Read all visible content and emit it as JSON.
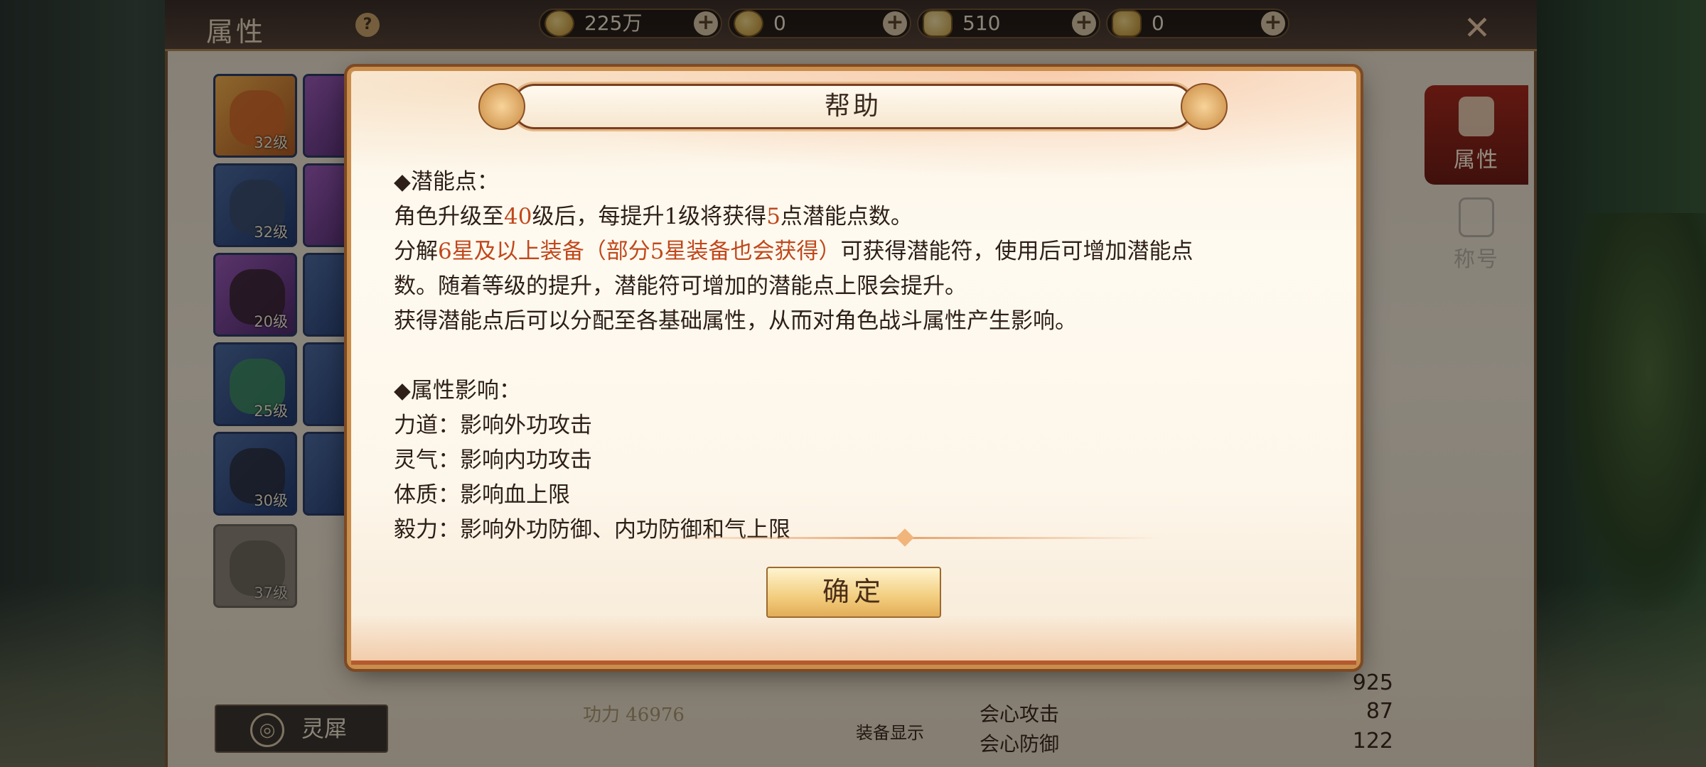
{
  "topbar": {
    "title": "属性",
    "help_symbol": "?",
    "currencies": [
      {
        "icon": "copper-coin-icon",
        "value": "225万"
      },
      {
        "icon": "gold-coin-icon",
        "value": "0"
      },
      {
        "icon": "silver-ingot-icon",
        "value": "510"
      },
      {
        "icon": "gold-ingot-icon",
        "value": "0"
      }
    ],
    "plus": "+",
    "close": "✕"
  },
  "equipment": [
    {
      "level": "32级",
      "rarity": "orange"
    },
    {
      "level": "32级",
      "rarity": "blue"
    },
    {
      "level": "20级",
      "rarity": "purple"
    },
    {
      "level": "25级",
      "rarity": "blue"
    },
    {
      "level": "30级",
      "rarity": "blue"
    },
    {
      "level": "37级",
      "rarity": "grey"
    }
  ],
  "bottom_left": {
    "label": "灵犀"
  },
  "side_tabs": [
    {
      "label": "属性",
      "active": true
    },
    {
      "label": "称号",
      "active": false
    }
  ],
  "background_stats": {
    "power": "功力 46976",
    "equip_display": "装备显示",
    "rows": [
      {
        "label": "会心攻击",
        "value": "87"
      },
      {
        "label": "会心防御",
        "value": "122"
      }
    ],
    "extra_value": "925"
  },
  "dialog": {
    "title": "帮助",
    "section1_heading": "◆潜能点：",
    "line1": {
      "a": "角色升级至",
      "b": "40",
      "c": "级后，每提升1级将获得",
      "d": "5",
      "e": "点潜能点数。"
    },
    "line2": {
      "a": "分解",
      "b": "6星及以上装备（部分5星装备也会获得）",
      "c": "可获得潜能符，使用后可增加潜能点"
    },
    "line3": "数。随着等级的提升，潜能符可增加的潜能点上限会提升。",
    "line4": "获得潜能点后可以分配至各基础属性，从而对角色战斗属性产生影响。",
    "section2_heading": "◆属性影响：",
    "attributes": [
      "力道：影响外功攻击",
      "灵气：影响内功攻击",
      "体质：影响血上限",
      "毅力：影响外功防御、内功防御和气上限"
    ],
    "confirm": "确定"
  },
  "colors": {
    "highlight": "#c0481c",
    "frame": "#c98d4c",
    "text": "#2e2018"
  }
}
